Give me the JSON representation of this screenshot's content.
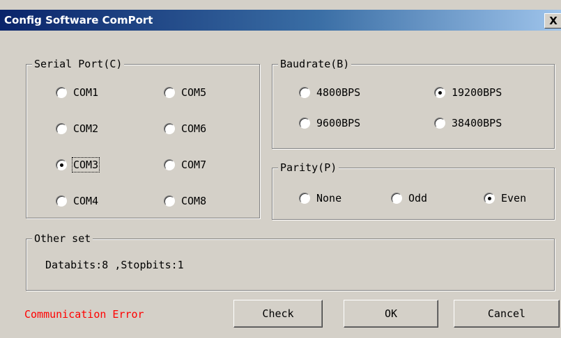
{
  "window": {
    "title": "Config Software ComPort",
    "close_label": "X"
  },
  "serial_port": {
    "label": "Serial Port(C)",
    "options": [
      {
        "label": "COM1",
        "selected": false
      },
      {
        "label": "COM2",
        "selected": false
      },
      {
        "label": "COM3",
        "selected": true
      },
      {
        "label": "COM4",
        "selected": false
      },
      {
        "label": "COM5",
        "selected": false
      },
      {
        "label": "COM6",
        "selected": false
      },
      {
        "label": "COM7",
        "selected": false
      },
      {
        "label": "COM8",
        "selected": false
      }
    ]
  },
  "baudrate": {
    "label": "Baudrate(B)",
    "options": [
      {
        "label": "4800BPS",
        "selected": false
      },
      {
        "label": "9600BPS",
        "selected": false
      },
      {
        "label": "19200BPS",
        "selected": true
      },
      {
        "label": "38400BPS",
        "selected": false
      }
    ]
  },
  "parity": {
    "label": "Parity(P)",
    "options": [
      {
        "label": "None",
        "selected": false
      },
      {
        "label": "Odd",
        "selected": false
      },
      {
        "label": "Even",
        "selected": true
      }
    ]
  },
  "other": {
    "label": "Other set",
    "text": "Databits:8 ,Stopbits:1"
  },
  "status": {
    "text": "Communication Error",
    "color": "#ff0000"
  },
  "buttons": {
    "check": "Check",
    "ok": "OK",
    "cancel": "Cancel"
  },
  "colors": {
    "dialog_bg": "#d4d0c8",
    "title_start": "#0a246a",
    "title_end": "#a6caf0",
    "title_text": "#ffffff"
  }
}
